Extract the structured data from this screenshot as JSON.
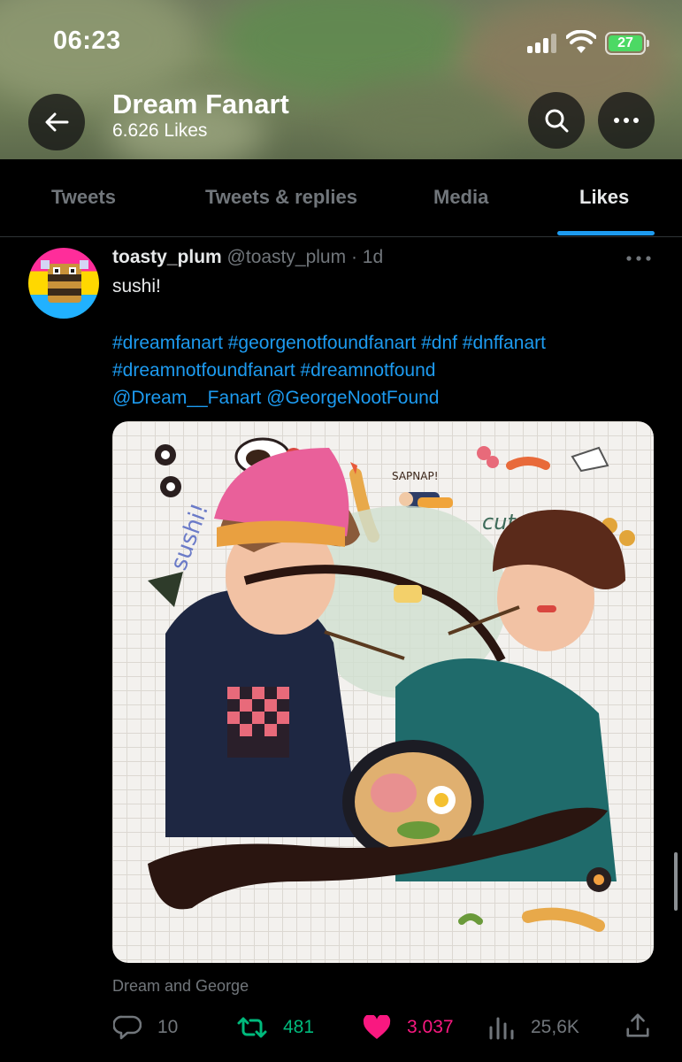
{
  "status_bar": {
    "time": "06:23",
    "battery": "27"
  },
  "header": {
    "title": "Dream Fanart",
    "subtitle": "6.626 Likes"
  },
  "tabs": [
    {
      "label": "Tweets"
    },
    {
      "label": "Tweets & replies"
    },
    {
      "label": "Media"
    },
    {
      "label": "Likes",
      "active": true
    }
  ],
  "tweet": {
    "name": "toasty_plum",
    "handle": "@toasty_plum",
    "separator": "·",
    "age": "1d",
    "text": "sushi!",
    "tags_line1": "#dreamfanart #georgenotfoundfanart #dnf #dnffanart",
    "tags_line2": "#dreamnotfoundfanart #dreamnotfound",
    "tags_line3": "@Dream__Fanart @GeorgeNootFound",
    "media_alt": "Dream and George",
    "media_texts": {
      "sapnap": "SAPNAP!",
      "cute_date": "cute date",
      "sushi": "sushi!"
    },
    "stats": {
      "replies": "10",
      "retweets": "481",
      "likes": "3.037",
      "views": "25,6K"
    }
  },
  "colors": {
    "background": "#000000",
    "accent": "#1d9bf0",
    "retweet": "#00ba7c",
    "like": "#f91880",
    "muted": "#71767b"
  },
  "icons": [
    "back-arrow-icon",
    "search-icon",
    "more-icon",
    "reply-icon",
    "retweet-icon",
    "heart-icon",
    "views-icon",
    "share-icon"
  ]
}
